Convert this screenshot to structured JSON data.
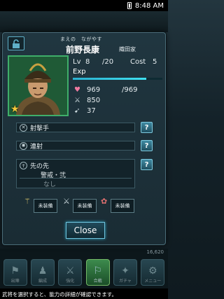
{
  "status_bar": {
    "time": "8:48 AM"
  },
  "general": {
    "furigana": "まえの　ながやす",
    "name": "前野長康",
    "clan": "織田家",
    "level_label": "Lv",
    "level": "8",
    "level_max": "/20",
    "cost_label": "Cost",
    "cost": "5",
    "exp_label": "Exp",
    "exp_progress": 0.82,
    "hp": "969",
    "hp_max": "/969",
    "attack": "850",
    "speed": "37"
  },
  "skills": [
    {
      "name": "射撃手",
      "icon": "crossed-arrows-icon"
    },
    {
      "name": "連射",
      "icon": "burst-icon"
    }
  ],
  "passive": {
    "name": "先の先",
    "line1": "警戒・弐",
    "line2": "なし"
  },
  "equipment": [
    {
      "icon": "weapon-icon",
      "label": "未装備"
    },
    {
      "icon": "armor-icon",
      "label": "未装備"
    },
    {
      "icon": "accessory-icon",
      "label": "未装備"
    }
  ],
  "help_label": "?",
  "close_label": "Close",
  "background": {
    "resource": "16,620",
    "tabs": [
      "出陣",
      "編成",
      "強化",
      "合戦",
      "ガチャ",
      "メニュー"
    ]
  },
  "hint": "武将を選択すると、能力の詳細が確認できます。",
  "colors": {
    "accent": "#6fc3dc",
    "frame": "#3fae6a",
    "star": "#f2c73a"
  }
}
